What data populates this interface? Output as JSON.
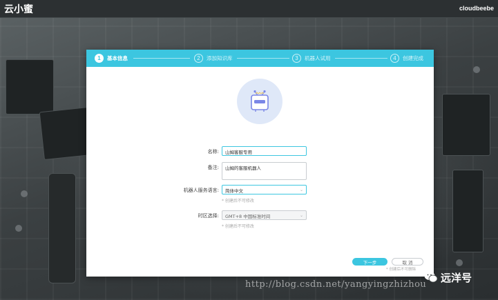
{
  "app": {
    "brand": "云小蜜",
    "brand_right": "cloudbeebe"
  },
  "steps": [
    {
      "num": "1",
      "label": "基本信息",
      "active": true
    },
    {
      "num": "2",
      "label": "添加知识库",
      "active": false
    },
    {
      "num": "3",
      "label": "机器人试用",
      "active": false
    },
    {
      "num": "4",
      "label": "创建完成",
      "active": false
    }
  ],
  "form": {
    "name": {
      "label": "名称:",
      "value": "山姆客服专用"
    },
    "remark": {
      "label": "备注:",
      "value": "山姆的客服机器人"
    },
    "language": {
      "label": "机器人服务语言:",
      "value": "简体中文",
      "hint": "* 创建后不可修改"
    },
    "timezone": {
      "label": "时区选择:",
      "value": "GMT+8 中国标准时间",
      "hint": "* 创建后不可修改"
    }
  },
  "actions": {
    "next": "下一步",
    "cancel": "取 消",
    "hint": "* 创建后不可删除"
  },
  "watermark": {
    "url": "http://blog.csdn.net/yangyingzhizhou",
    "logo_text": "远洋号"
  },
  "colors": {
    "accent": "#3cc6e0",
    "topbar": "#2c3032",
    "avatar_bg": "#dfe8f8",
    "robot": "#7b87e6"
  }
}
